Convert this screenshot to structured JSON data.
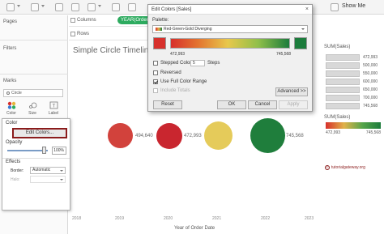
{
  "toolbar": {
    "show_me_label": "Show Me"
  },
  "left_panel": {
    "pages_label": "Pages",
    "filters_label": "Filters",
    "marks_label": "Marks",
    "mark_type": "Circle",
    "mark_buttons": [
      "Color",
      "Size",
      "Label"
    ]
  },
  "color_popup": {
    "color_label": "Color",
    "edit_colors_label": "Edit Colors...",
    "opacity_label": "Opacity",
    "opacity_value": "100%",
    "opacity_level": 1.0,
    "effects_label": "Effects",
    "border_label": "Border:",
    "border_value": "Automatic",
    "halo_label": "Halo:"
  },
  "shelves": {
    "columns_label": "Columns",
    "rows_label": "Rows",
    "columns_pill": "YEAR(Order Date)"
  },
  "viz": {
    "title": "Simple Circle Timeline",
    "x_axis_title": "Year of Order Date",
    "years": [
      "2018",
      "2019",
      "2020",
      "2021",
      "2022",
      "2023"
    ],
    "circles": [
      {
        "year": "2019",
        "label": "494,640",
        "color": "#d2423c"
      },
      {
        "year": "2020",
        "label": "472,993",
        "color": "#c9262f"
      },
      {
        "year": "2021",
        "label": "",
        "color": "#e5cb5a"
      },
      {
        "year": "2022",
        "label": "745,568",
        "color": "#1f7e3c"
      }
    ]
  },
  "watermark": "tutorialgateway.org",
  "legend_sum": {
    "title": "SUM(Sales)",
    "labels": [
      "472,993",
      "500,000",
      "550,000",
      "600,000",
      "650,000",
      "700,000",
      "745,568"
    ]
  },
  "legend_gradient": {
    "title": "SUM(Sales)",
    "min": "472,993",
    "max": "745,568"
  },
  "dialog": {
    "title": "Edit Colors [Sales]",
    "palette_label": "Palette:",
    "palette_value": "Red-Green-Gold Diverging",
    "range_min": "472,993",
    "range_max": "745,568",
    "stepped_color_label": "Stepped Color",
    "steps_value": "5",
    "steps_label": "Steps",
    "reversed_label": "Reversed",
    "full_range_label": "Use Full Color Range",
    "include_totals_label": "Include Totals",
    "advanced_label": "Advanced >>",
    "reset_label": "Reset",
    "ok_label": "OK",
    "cancel_label": "Cancel",
    "apply_label": "Apply",
    "checks": {
      "stepped": false,
      "reversed": false,
      "full_range": true,
      "include_totals": false
    }
  }
}
